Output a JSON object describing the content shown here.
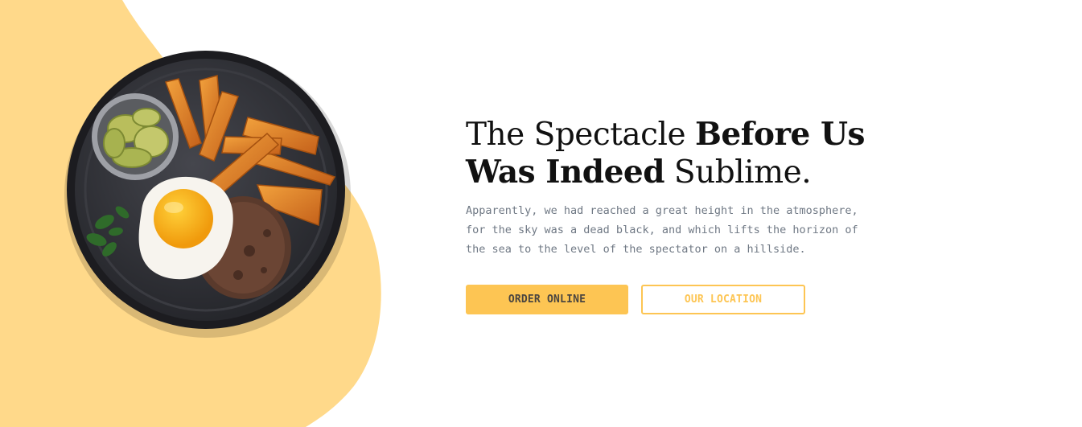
{
  "colors": {
    "accent": "#fdc553",
    "blob": "#ffd98a",
    "headline": "#111111",
    "body_text": "#6f7884"
  },
  "hero": {
    "image_name": "plate-egg-steak-fries",
    "headline": {
      "part1": "The Spectacle ",
      "part2_bold": "Before Us",
      "part3_bold": "Was Indeed",
      "part4": " Sublime."
    },
    "description": "Apparently, we had reached a great height in the atmosphere, for the sky was a dead black, and which lifts the horizon of the sea to the level of the spectator on a hillside.",
    "buttons": {
      "order_online": "ORDER ONLINE",
      "our_location": "OUR LOCATION"
    }
  }
}
